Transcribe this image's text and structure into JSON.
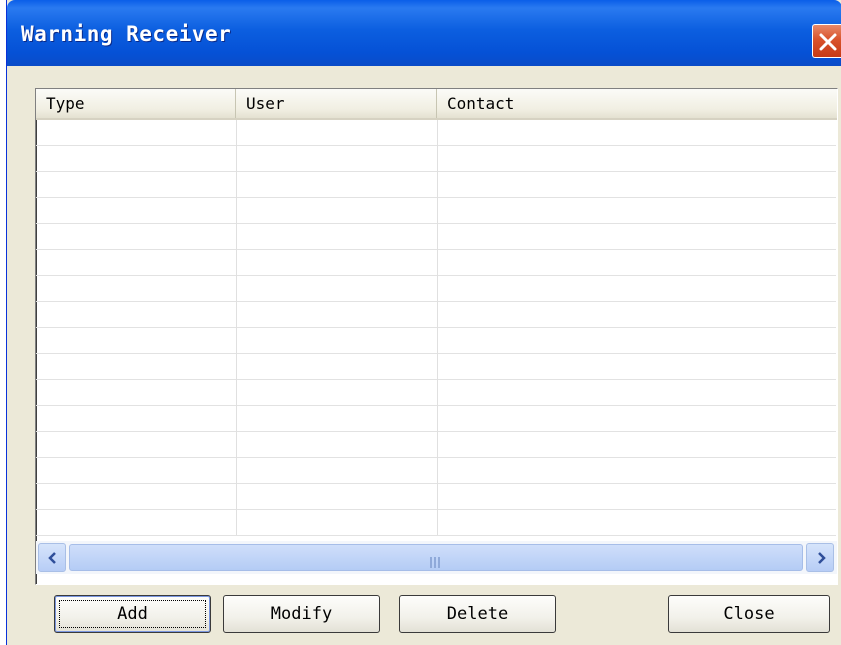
{
  "window": {
    "title": "Warning Receiver"
  },
  "table": {
    "columns": [
      "Type",
      "User",
      "Contact"
    ],
    "rows": []
  },
  "buttons": {
    "add": "Add",
    "modify": "Modify",
    "delete": "Delete",
    "close": "Close"
  },
  "icons": {
    "close": "close-icon",
    "scroll_left": "chevron-left-icon",
    "scroll_right": "chevron-right-icon"
  },
  "colors": {
    "titlebar": "#0a5ee8",
    "close_button": "#d9532c",
    "dialog_background": "#ece9d8"
  }
}
